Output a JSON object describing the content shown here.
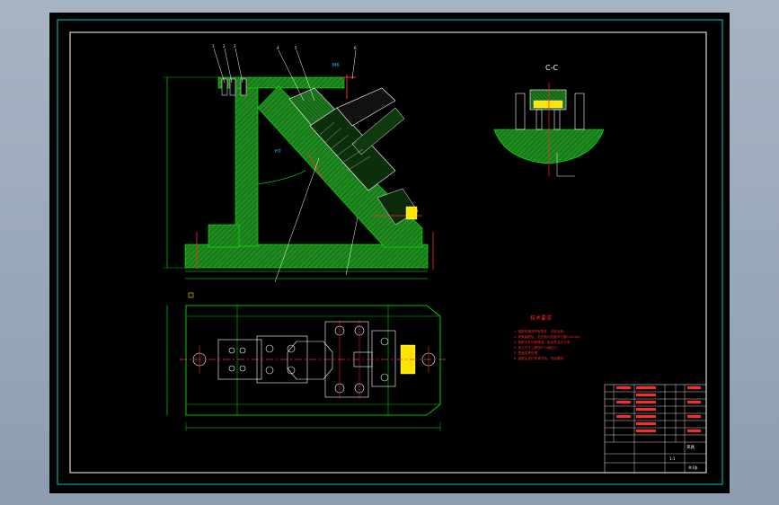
{
  "drawing": {
    "section_label": "C-C",
    "tech_req_title": "技术要求",
    "tech_req_items": [
      "1. 装配前清洗所有零件，去除毛刺。",
      "2. 夹具装配后，定位面与底面平行度0.02mm。",
      "3. 各配合处加润滑油，运动灵活无卡滞。",
      "4. 未注尺寸公差按IT12级加工。",
      "5. 表面发黑处理。",
      "6. 装配后进行夹紧试验，符合要求。"
    ],
    "title_block": {
      "drawing_name": "夹具",
      "scale": "1:1",
      "sheet": "共1张"
    }
  },
  "colors": {
    "background": "#000000",
    "frame": "#ffffff",
    "outer_frame": "#00c8c8",
    "part_fill": "#1f8a1f",
    "part_hatch": "#0d4d0d",
    "dimension": "#ffffff",
    "red": "#ff2a2a",
    "cyan": "#00d8ff",
    "yellow": "#ffe400",
    "green_line": "#00ff00"
  }
}
